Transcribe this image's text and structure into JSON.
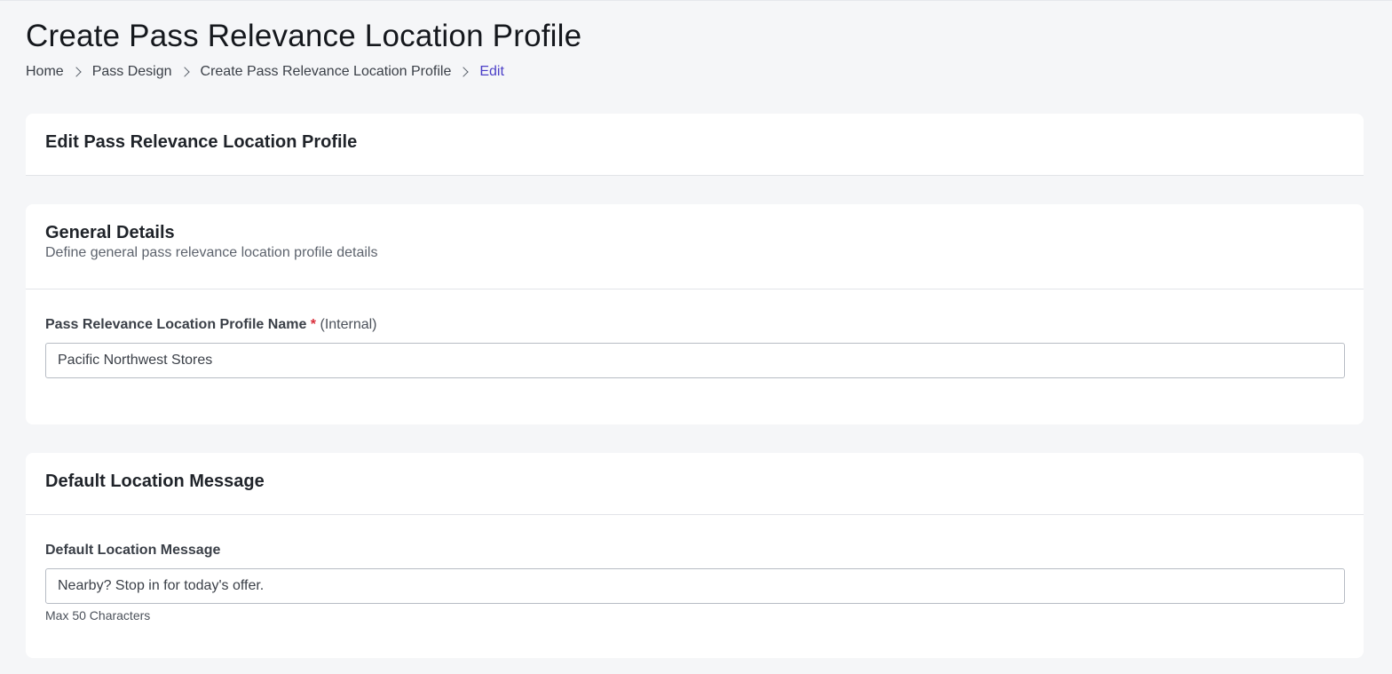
{
  "page": {
    "title": "Create Pass Relevance Location Profile"
  },
  "breadcrumb": [
    {
      "label": "Home"
    },
    {
      "label": "Pass Design"
    },
    {
      "label": "Create Pass Relevance Location Profile"
    },
    {
      "label": "Edit"
    }
  ],
  "edit_card": {
    "title": "Edit Pass Relevance Location Profile"
  },
  "general_details": {
    "title": "General Details",
    "subtitle": "Define general pass relevance location profile details",
    "name_field": {
      "label": "Pass Relevance Location Profile Name",
      "required_mark": "*",
      "note": "(Internal)",
      "value": "Pacific Northwest Stores"
    }
  },
  "default_location_message": {
    "title": "Default Location Message",
    "message_field": {
      "label": "Default Location Message",
      "value": "Nearby? Stop in for today's offer.",
      "hint": "Max 50 Characters"
    }
  },
  "colors": {
    "background": "#f5f6f8",
    "card": "#ffffff",
    "active_breadcrumb": "#4b3fc7",
    "required": "#d92d3a"
  }
}
